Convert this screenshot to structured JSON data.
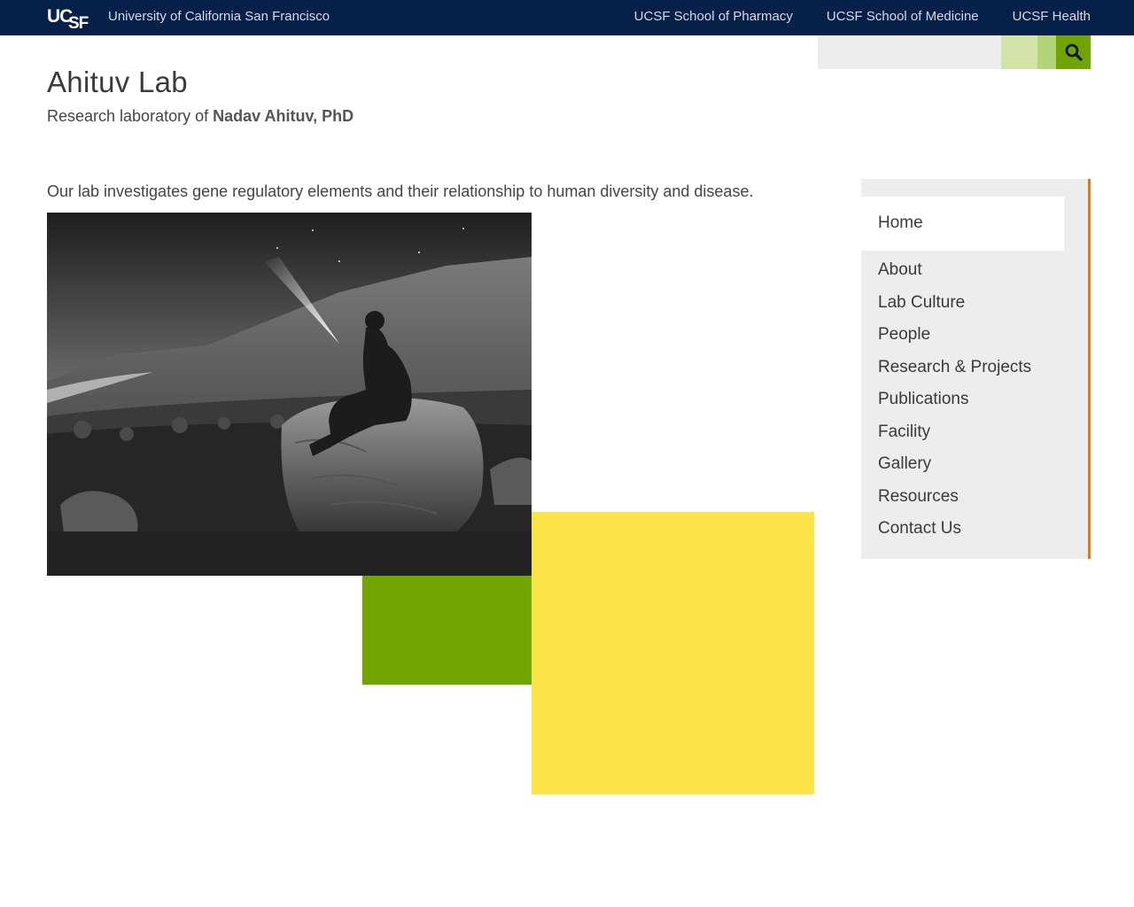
{
  "topbar": {
    "logo_text": "UCSF",
    "university": "University of California San Francisco",
    "links": [
      "UCSF School of Pharmacy",
      "UCSF School of Medicine",
      "UCSF Health"
    ],
    "background": "#052049"
  },
  "search": {
    "placeholder": "",
    "button_icon": "search-icon",
    "accent": "#71a303"
  },
  "header": {
    "title": "Ahituv Lab",
    "subtitle_prefix": "Research laboratory of",
    "subtitle_name": "Nadav Ahituv, PhD"
  },
  "main": {
    "intro": "Our lab investigates gene regulatory elements and their relationship to human diversity and disease.",
    "hero_image": "black-and-white photo of a person on a rock holding a flashlight toward the night sky",
    "blocks": {
      "green": "#71a500",
      "yellow": "#fce449"
    }
  },
  "sidebar": {
    "home": "Home",
    "items": [
      "About",
      "Lab Culture",
      "People",
      "Research & Projects",
      "Publications",
      "Facility",
      "Gallery",
      "Resources",
      "Contact Us"
    ],
    "border_color": "#e07a1f"
  }
}
